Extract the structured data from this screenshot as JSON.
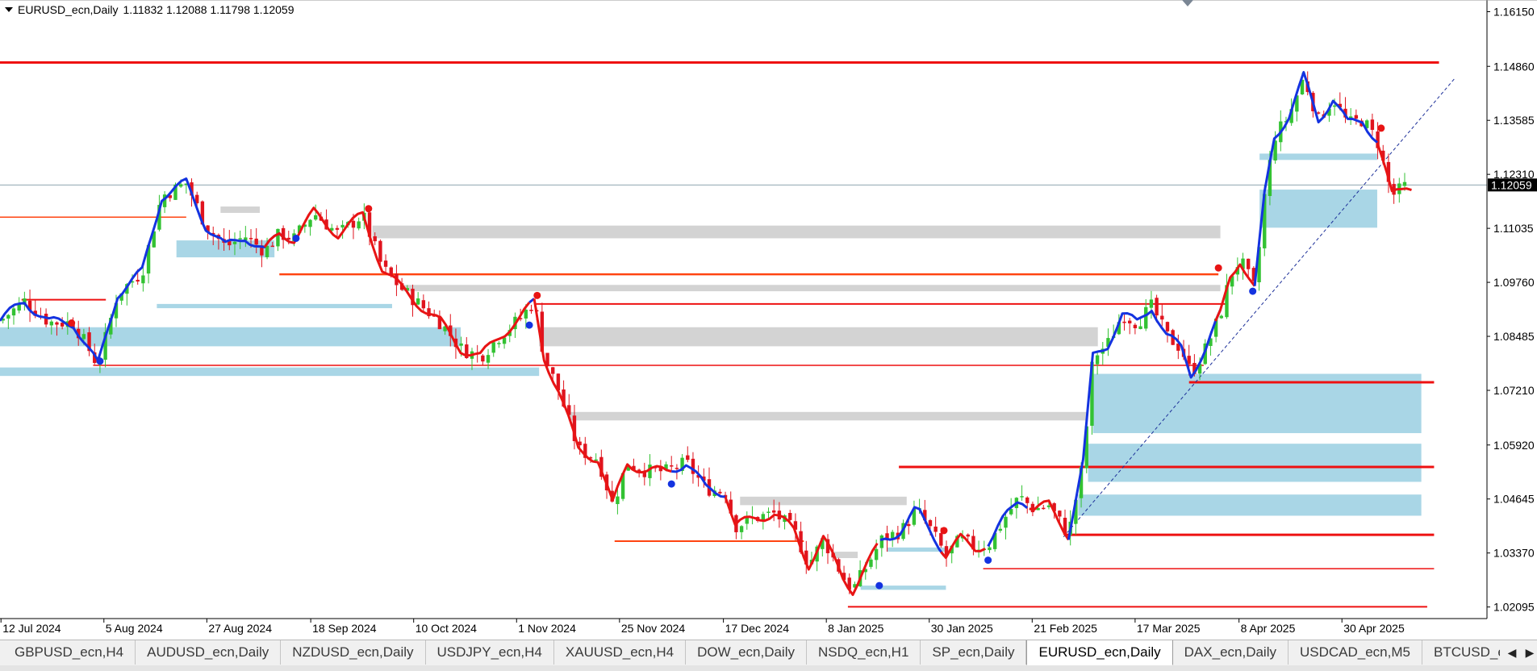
{
  "header": {
    "symbol": "EURUSD_ecn,Daily",
    "ohlc": "1.11832 1.12088 1.11798 1.12059"
  },
  "price_axis": {
    "labels": [
      "1.16150",
      "1.14860",
      "1.13585",
      "1.12310",
      "1.11035",
      "1.09760",
      "1.08485",
      "1.07210",
      "1.05920",
      "1.04645",
      "1.03370",
      "1.02095"
    ],
    "current_price": "1.12059"
  },
  "time_axis": {
    "labels": [
      "12 Jul 2024",
      "5 Aug 2024",
      "27 Aug 2024",
      "18 Sep 2024",
      "10 Oct 2024",
      "1 Nov 2024",
      "25 Nov 2024",
      "17 Dec 2024",
      "8 Jan 2025",
      "30 Jan 2025",
      "21 Feb 2025",
      "17 Mar 2025",
      "8 Apr 2025",
      "30 Apr 2025"
    ]
  },
  "tabs": [
    {
      "label": "GBPUSD_ecn,H4",
      "active": false
    },
    {
      "label": "AUDUSD_ecn,Daily",
      "active": false
    },
    {
      "label": "NZDUSD_ecn,Daily",
      "active": false
    },
    {
      "label": "USDJPY_ecn,H4",
      "active": false
    },
    {
      "label": "XAUUSD_ecn,H4",
      "active": false
    },
    {
      "label": "DOW_ecn,Daily",
      "active": false
    },
    {
      "label": "NSDQ_ecn,H1",
      "active": false
    },
    {
      "label": "SP_ecn,Daily",
      "active": false
    },
    {
      "label": "EURUSD_ecn,Daily",
      "active": true
    },
    {
      "label": "DAX_ecn,Daily",
      "active": false
    },
    {
      "label": "USDCAD_ecn,M5",
      "active": false
    },
    {
      "label": "BTCUSD_ec",
      "active": false
    }
  ],
  "colors": {
    "bull": "#33c233",
    "bear": "#e0141e",
    "trend_up": "#1433e0",
    "trend_down": "#e81414",
    "zone_blue": "#a9d6e6",
    "zone_gray": "#d3d3d3",
    "level_red": "#ee1111",
    "level_orange": "#ff4411",
    "price_line": "#8fa4b0"
  },
  "chart_data": {
    "type": "candlestick",
    "symbol": "EURUSD_ecn",
    "timeframe": "Daily",
    "last_bar": {
      "open": 1.11832,
      "high": 1.12088,
      "low": 1.11798,
      "close": 1.12059
    },
    "y_range": [
      1.0165,
      1.1635
    ],
    "close_path": [
      [
        0,
        1.0885
      ],
      [
        25,
        1.0932
      ],
      [
        50,
        1.0882
      ],
      [
        75,
        1.088
      ],
      [
        100,
        1.078
      ],
      [
        120,
        1.095
      ],
      [
        145,
        1.1
      ],
      [
        165,
        1.118
      ],
      [
        190,
        1.121
      ],
      [
        210,
        1.111
      ],
      [
        230,
        1.106
      ],
      [
        250,
        1.1085
      ],
      [
        270,
        1.105
      ],
      [
        285,
        1.109
      ],
      [
        300,
        1.108
      ],
      [
        320,
        1.114
      ],
      [
        345,
        1.109
      ],
      [
        370,
        1.1135
      ],
      [
        390,
        1.101
      ],
      [
        410,
        1.096
      ],
      [
        430,
        1.092
      ],
      [
        450,
        1.088
      ],
      [
        470,
        1.082
      ],
      [
        490,
        1.08
      ],
      [
        510,
        1.085
      ],
      [
        530,
        1.089
      ],
      [
        545,
        1.093
      ],
      [
        555,
        1.08
      ],
      [
        570,
        1.072
      ],
      [
        590,
        1.058
      ],
      [
        610,
        1.056
      ],
      [
        625,
        1.045
      ],
      [
        640,
        1.055
      ],
      [
        660,
        1.053
      ],
      [
        680,
        1.053
      ],
      [
        700,
        1.055
      ],
      [
        720,
        1.049
      ],
      [
        740,
        1.048
      ],
      [
        750,
        1.04
      ],
      [
        770,
        1.042
      ],
      [
        790,
        1.043
      ],
      [
        810,
        1.039
      ],
      [
        825,
        1.031
      ],
      [
        840,
        1.037
      ],
      [
        860,
        1.028
      ],
      [
        870,
        1.025
      ],
      [
        885,
        1.031
      ],
      [
        900,
        1.037
      ],
      [
        920,
        1.039
      ],
      [
        935,
        1.044
      ],
      [
        950,
        1.039
      ],
      [
        965,
        1.033
      ],
      [
        980,
        1.037
      ],
      [
        995,
        1.035
      ],
      [
        1010,
        1.036
      ],
      [
        1025,
        1.042
      ],
      [
        1040,
        1.047
      ],
      [
        1055,
        1.044
      ],
      [
        1070,
        1.045
      ],
      [
        1090,
        1.038
      ],
      [
        1105,
        1.055
      ],
      [
        1115,
        1.08
      ],
      [
        1130,
        1.083
      ],
      [
        1145,
        1.09
      ],
      [
        1160,
        1.088
      ],
      [
        1175,
        1.092
      ],
      [
        1190,
        1.085
      ],
      [
        1205,
        1.082
      ],
      [
        1215,
        1.076
      ],
      [
        1230,
        1.082
      ],
      [
        1245,
        1.09
      ],
      [
        1255,
        1.099
      ],
      [
        1265,
        1.103
      ],
      [
        1280,
        1.096
      ],
      [
        1290,
        1.118
      ],
      [
        1300,
        1.132
      ],
      [
        1315,
        1.137
      ],
      [
        1330,
        1.146
      ],
      [
        1345,
        1.136
      ],
      [
        1360,
        1.141
      ],
      [
        1375,
        1.135
      ],
      [
        1390,
        1.136
      ],
      [
        1405,
        1.131
      ],
      [
        1420,
        1.118
      ],
      [
        1435,
        1.1206
      ]
    ],
    "trend_segments": [
      {
        "dir": "up",
        "from": 0,
        "to": 300
      },
      {
        "dir": "down",
        "from": 270,
        "to": 540
      },
      {
        "dir": "up",
        "from": 540,
        "to": 545
      },
      {
        "dir": "down",
        "from": 545,
        "to": 685
      },
      {
        "dir": "up",
        "from": 685,
        "to": 740
      },
      {
        "dir": "down",
        "from": 740,
        "to": 898
      },
      {
        "dir": "up",
        "from": 898,
        "to": 965
      },
      {
        "dir": "down",
        "from": 960,
        "to": 1008
      },
      {
        "dir": "up",
        "from": 1008,
        "to": 1050
      },
      {
        "dir": "down",
        "from": 1050,
        "to": 1090
      },
      {
        "dir": "up",
        "from": 1090,
        "to": 1245
      },
      {
        "dir": "down",
        "from": 1240,
        "to": 1280
      },
      {
        "dir": "up",
        "from": 1280,
        "to": 1405
      },
      {
        "dir": "down",
        "from": 1405,
        "to": 1440
      }
    ],
    "signal_dots": [
      {
        "x": 73,
        "price": 1.088,
        "dir": "down"
      },
      {
        "x": 102,
        "price": 1.079,
        "dir": "up"
      },
      {
        "x": 302,
        "price": 1.108,
        "dir": "up"
      },
      {
        "x": 376,
        "price": 1.115,
        "dir": "down"
      },
      {
        "x": 540,
        "price": 1.0875,
        "dir": "up"
      },
      {
        "x": 548,
        "price": 1.0945,
        "dir": "down"
      },
      {
        "x": 685,
        "price": 1.05,
        "dir": "up"
      },
      {
        "x": 897,
        "price": 1.026,
        "dir": "up"
      },
      {
        "x": 963,
        "price": 1.039,
        "dir": "down"
      },
      {
        "x": 1008,
        "price": 1.032,
        "dir": "up"
      },
      {
        "x": 1243,
        "price": 1.101,
        "dir": "down"
      },
      {
        "x": 1278,
        "price": 1.0955,
        "dir": "up"
      },
      {
        "x": 1409,
        "price": 1.134,
        "dir": "down"
      }
    ],
    "levels": [
      {
        "price": 1.1495,
        "x1": 0,
        "x2": 1468,
        "color": "level_red",
        "width": 3
      },
      {
        "price": 1.113,
        "x1": 0,
        "x2": 190,
        "color": "level_orange",
        "width": 1.5
      },
      {
        "price": 1.0995,
        "x1": 285,
        "x2": 1243,
        "color": "level_orange",
        "width": 2.5
      },
      {
        "price": 1.0935,
        "x1": 22,
        "x2": 108,
        "color": "level_red",
        "width": 2
      },
      {
        "price": 1.0925,
        "x1": 547,
        "x2": 1253,
        "color": "level_red",
        "width": 2
      },
      {
        "price": 1.078,
        "x1": 95,
        "x2": 1228,
        "color": "level_red",
        "width": 1.5
      },
      {
        "price": 1.074,
        "x1": 1213,
        "x2": 1463,
        "color": "level_red",
        "width": 3
      },
      {
        "price": 1.054,
        "x1": 917,
        "x2": 1463,
        "color": "level_red",
        "width": 3
      },
      {
        "price": 1.038,
        "x1": 1088,
        "x2": 1463,
        "color": "level_red",
        "width": 3
      },
      {
        "price": 1.0365,
        "x1": 627,
        "x2": 820,
        "color": "level_orange",
        "width": 2
      },
      {
        "price": 1.03,
        "x1": 1003,
        "x2": 1463,
        "color": "level_red",
        "width": 1.5
      },
      {
        "price": 1.021,
        "x1": 865,
        "x2": 1456,
        "color": "level_red",
        "width": 2
      }
    ],
    "zones": [
      {
        "x1": 1285,
        "x2": 1405,
        "p_top": 1.128,
        "p_bot": 1.1265,
        "color": "zone_blue"
      },
      {
        "x1": 1285,
        "x2": 1405,
        "p_top": 1.1195,
        "p_bot": 1.1105,
        "color": "zone_blue"
      },
      {
        "x1": 380,
        "x2": 1245,
        "p_top": 1.111,
        "p_bot": 1.108,
        "color": "zone_gray"
      },
      {
        "x1": 180,
        "x2": 280,
        "p_top": 1.1075,
        "p_bot": 1.1035,
        "color": "zone_blue"
      },
      {
        "x1": 225,
        "x2": 265,
        "p_top": 1.1155,
        "p_bot": 1.114,
        "color": "zone_gray"
      },
      {
        "x1": 410,
        "x2": 1245,
        "p_top": 1.097,
        "p_bot": 1.0955,
        "color": "zone_gray"
      },
      {
        "x1": 160,
        "x2": 400,
        "p_top": 1.0925,
        "p_bot": 1.0915,
        "color": "zone_blue"
      },
      {
        "x1": 0,
        "x2": 470,
        "p_top": 1.087,
        "p_bot": 1.0825,
        "color": "zone_blue"
      },
      {
        "x1": 550,
        "x2": 1120,
        "p_top": 1.087,
        "p_bot": 1.0825,
        "color": "zone_gray"
      },
      {
        "x1": 0,
        "x2": 550,
        "p_top": 1.0775,
        "p_bot": 1.0755,
        "color": "zone_blue"
      },
      {
        "x1": 1115,
        "x2": 1450,
        "p_top": 1.076,
        "p_bot": 1.062,
        "color": "zone_blue"
      },
      {
        "x1": 580,
        "x2": 1110,
        "p_top": 1.067,
        "p_bot": 1.065,
        "color": "zone_gray"
      },
      {
        "x1": 1110,
        "x2": 1450,
        "p_top": 1.0595,
        "p_bot": 1.0505,
        "color": "zone_blue"
      },
      {
        "x1": 1100,
        "x2": 1450,
        "p_top": 1.0475,
        "p_bot": 1.0425,
        "color": "zone_blue"
      },
      {
        "x1": 755,
        "x2": 925,
        "p_top": 1.047,
        "p_bot": 1.045,
        "color": "zone_gray"
      },
      {
        "x1": 905,
        "x2": 965,
        "p_top": 1.035,
        "p_bot": 1.034,
        "color": "zone_blue"
      },
      {
        "x1": 848,
        "x2": 875,
        "p_top": 1.034,
        "p_bot": 1.0325,
        "color": "zone_gray"
      },
      {
        "x1": 878,
        "x2": 965,
        "p_top": 1.026,
        "p_bot": 1.025,
        "color": "zone_blue"
      }
    ],
    "trendline": {
      "x1": 1085,
      "p1": 1.0375,
      "x2": 1485,
      "p2": 1.146
    }
  }
}
